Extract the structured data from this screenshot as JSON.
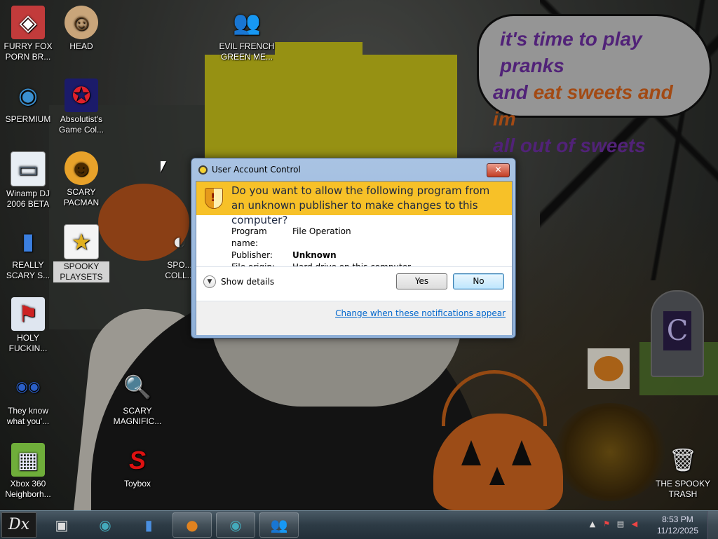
{
  "wallpaper": {
    "speech_bubble": {
      "line1": "it's time to play pranks",
      "line2a": "and ",
      "line2b": "eat sweets and im",
      "line3": "all out of sweets"
    },
    "colors": {
      "bubble_purple": "#6d2ea0",
      "bubble_orange": "#d8631b",
      "hat_yellow": "#c8c21a",
      "pumpkin_orange": "#d1661f"
    }
  },
  "desktop_icons": [
    {
      "label": "FURRY FOX PORN BR...",
      "icon": "red-cube-icon",
      "glyph": "◈"
    },
    {
      "label": "HEAD",
      "icon": "face-photo-icon",
      "glyph": "☺"
    },
    {
      "label": "EVIL FRENCH GREEN ME...",
      "icon": "green-messenger-icon",
      "glyph": "👥"
    },
    {
      "label": "SPERMIUM",
      "icon": "browser-globe-icon",
      "glyph": "◉"
    },
    {
      "label": "Absolutist's Game Col...",
      "icon": "pentagram-icon",
      "glyph": "✪"
    },
    {
      "label": "Winamp DJ 2006 BETA",
      "icon": "window-app-icon",
      "glyph": "▭"
    },
    {
      "label": "SCARY PACMAN",
      "icon": "pumpkin-face-icon",
      "glyph": "☻"
    },
    {
      "label": "REALLY SCARY S...",
      "icon": "usb-drive-icon",
      "glyph": "▮"
    },
    {
      "label": "SPOOKY PLAYSETS",
      "icon": "star-sticker-icon",
      "glyph": "★"
    },
    {
      "label": "SPO... COLL...",
      "icon": "partial-folder-icon",
      "glyph": "◐"
    },
    {
      "label": "HOLY FUCKIN...",
      "icon": "network-map-icon",
      "glyph": "⚑"
    },
    {
      "label": "They know what you'...",
      "icon": "eyes-icon",
      "glyph": "◉◉"
    },
    {
      "label": "SCARY MAGNIFIC...",
      "icon": "magnifier-icon",
      "glyph": "🔍"
    },
    {
      "label": "Xbox 360 Neighborh...",
      "icon": "xbox-icon",
      "glyph": "▦"
    },
    {
      "label": "Toybox",
      "icon": "red-s-icon",
      "glyph": "S"
    },
    {
      "label": "THE SPOOKY TRASH",
      "icon": "trash-bin-icon",
      "glyph": "🗑"
    }
  ],
  "uac": {
    "title": "User Account Control",
    "close_glyph": "✕",
    "question": "Do you want to allow the following program from an unknown publisher to make changes to this computer?",
    "fields": [
      {
        "key": "Program name:",
        "value": "File Operation",
        "bold": false
      },
      {
        "key": "Publisher:",
        "value": "Unknown",
        "bold": true
      },
      {
        "key": "File origin:",
        "value": "Hard drive on this computer",
        "bold": false
      }
    ],
    "show_details": "Show details",
    "yes": "Yes",
    "no": "No",
    "link": "Change when these notifications appear",
    "colors": {
      "banner": "#f7c128",
      "link": "#0066cc"
    }
  },
  "taskbar": {
    "start_label": "Dx",
    "buttons": [
      {
        "name": "explorer-icon",
        "glyph": "▣"
      },
      {
        "name": "browser-globe-icon",
        "glyph": "◉"
      },
      {
        "name": "usb-drive-icon",
        "glyph": "▮"
      },
      {
        "name": "pumpkin-icon",
        "glyph": "●"
      },
      {
        "name": "browser-globe-icon-2",
        "glyph": "◉"
      },
      {
        "name": "messenger-icon",
        "glyph": "👥"
      }
    ],
    "clock_time": "8:53 PM",
    "clock_date": "11/12/2025"
  }
}
